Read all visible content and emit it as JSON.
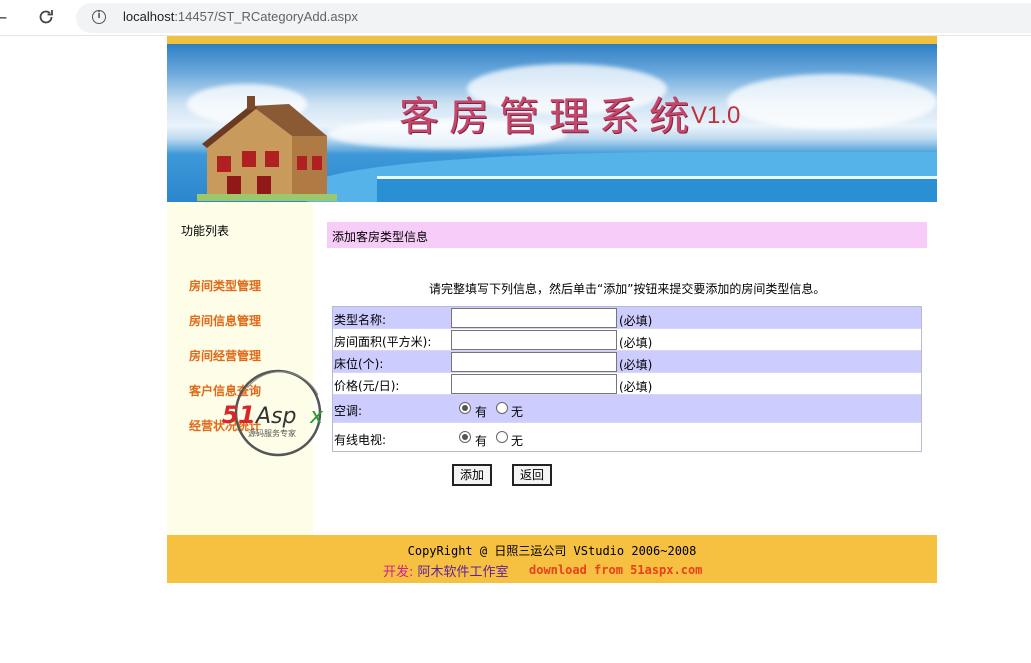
{
  "browser": {
    "back_glyph": "←",
    "url_host": "localhost",
    "url_rest": ":14457/ST_RCategoryAdd.aspx",
    "info_glyph": "i"
  },
  "banner": {
    "title": "客房管理系统",
    "version": "V1.0"
  },
  "sidebar": {
    "title": "功能列表",
    "items": [
      {
        "label": "房间类型管理"
      },
      {
        "label": "房间信息管理"
      },
      {
        "label": "房间经营管理"
      },
      {
        "label": "客户信息查询"
      },
      {
        "label": "经营状况统计"
      }
    ]
  },
  "main": {
    "section_title": "添加客房类型信息",
    "intro": "请完整填写下列信息，然后单击“添加”按钮来提交要添加的房间类型信息。",
    "fields": [
      {
        "label": "类型名称:",
        "value": "",
        "required": "(必填)"
      },
      {
        "label": "房间面积(平方米):",
        "value": "",
        "required": "(必填)"
      },
      {
        "label": "床位(个):",
        "value": "",
        "required": "(必填)"
      },
      {
        "label": "价格(元/日):",
        "value": "",
        "required": "(必填)"
      }
    ],
    "aircon": {
      "label": "空调:",
      "yes": "有",
      "no": "无",
      "selected": "有"
    },
    "tv": {
      "label": "有线电视:",
      "yes": "有",
      "no": "无",
      "selected": "有"
    },
    "add_button": "添加",
    "back_button": "返回"
  },
  "watermark": {
    "logo_text": "51Aspx",
    "logo_sub": "源码服务专家"
  },
  "footer": {
    "line1": "CopyRight @ 日照三运公司 VStudio 2006~2008",
    "dev_label": "开发:",
    "dev_studio": "阿木软件工作室",
    "download": "download from 51aspx.com"
  },
  "colors": {
    "accent": "#f6c040",
    "section_bg": "#f8ccf8",
    "row_shade": "#ccccff",
    "nav_link": "#e06a18"
  }
}
